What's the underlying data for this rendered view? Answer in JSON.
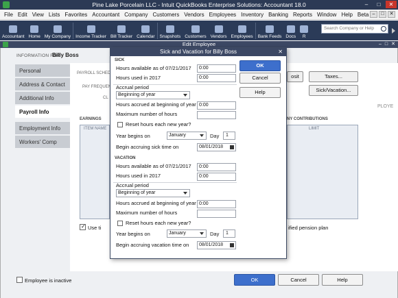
{
  "app": {
    "title": "Pine Lake Porcelain LLC  -  Intuit QuickBooks Enterprise Solutions: Accountant 18.0",
    "window_buttons": [
      "–",
      "□",
      "✕"
    ]
  },
  "menubar": {
    "items": [
      "File",
      "Edit",
      "View",
      "Lists",
      "Favorites",
      "Accountant",
      "Company",
      "Customers",
      "Vendors",
      "Employees",
      "Inventory",
      "Banking",
      "Reports",
      "Window",
      "Help",
      "Beta"
    ],
    "right_buttons": [
      "–",
      "□",
      "✕"
    ]
  },
  "iconbar": {
    "items": [
      {
        "label": "Accountant",
        "icon": "accountant-icon"
      },
      {
        "label": "Home",
        "icon": "home-icon"
      },
      {
        "label": "My Company",
        "icon": "my-company-icon"
      },
      {
        "label": "Income Tracker",
        "icon": "income-tracker-icon"
      },
      {
        "label": "Bill Tracker",
        "icon": "bill-tracker-icon"
      },
      {
        "label": "Calendar",
        "icon": "calendar-icon"
      },
      {
        "label": "Snapshots",
        "icon": "snapshots-icon"
      },
      {
        "label": "Customers",
        "icon": "customers-icon"
      },
      {
        "label": "Vendors",
        "icon": "vendors-icon"
      },
      {
        "label": "Employees",
        "icon": "employees-icon"
      },
      {
        "label": "Bank Feeds",
        "icon": "bank-feeds-icon"
      },
      {
        "label": "Docs",
        "icon": "docs-icon"
      },
      {
        "label": "R",
        "icon": "reports-icon"
      }
    ],
    "search_placeholder": "Search Company or Help"
  },
  "edit_employee": {
    "title": "Edit Employee",
    "title_controls": [
      "–",
      "□",
      "✕"
    ],
    "info_for_label": "INFORMATION FOR",
    "employee_name": "Billy Boss",
    "tabs": [
      "Personal",
      "Address & Contact",
      "Additional Info",
      "Payroll Info",
      "Employment Info",
      "Workers' Comp"
    ],
    "background": {
      "payroll_schedule_label": "PAYROLL SCHEDU",
      "pay_frequency_label": "PAY FREQUEN",
      "class_label": "CL",
      "direct_deposit_btn": "osit",
      "taxes_btn": "Taxes...",
      "sick_vacation_btn": "Sick/Vacation...",
      "earnings_label": "EARNINGS",
      "item_name_header": "ITEM NAME",
      "contributions_label": "NY CONTRIBUTIONS",
      "limit_header": "LIMIT",
      "right_cut_label": "PLOYE",
      "use_time_label": "Use ti",
      "pension_label": "ified pension plan"
    },
    "employee_inactive_label": "Employee is inactive",
    "ok_label": "OK",
    "cancel_label": "Cancel",
    "help_label": "Help"
  },
  "sick_vacation_dialog": {
    "title": "Sick and Vacation for Billy Boss",
    "close": "✕",
    "sick": {
      "section_label": "SICK",
      "hours_available_label": "Hours available as of 07/21/2017",
      "hours_available_value": "0:00",
      "hours_used_label": "Hours used in 2017",
      "hours_used_value": "0:00",
      "accrual_period_label": "Accrual period",
      "accrual_period_value": "Beginning of year",
      "hours_accrued_label": "Hours accrued at beginning of year",
      "hours_accrued_value": "0:00",
      "max_hours_label": "Maximum number of hours",
      "max_hours_value": "",
      "reset_label": "Reset hours each new year?",
      "year_begins_label": "Year begins on",
      "year_begins_value": "January",
      "day_label": "Day",
      "day_value": "1",
      "begin_accruing_label": "Begin accruing sick time on",
      "begin_accruing_value": "08/01/2018"
    },
    "vacation": {
      "section_label": "VACATION",
      "hours_available_label": "Hours available as of 07/21/2017",
      "hours_available_value": "0:00",
      "hours_used_label": "Hours used in 2017",
      "hours_used_value": "0:00",
      "accrual_period_label": "Accrual period",
      "accrual_period_value": "Beginning of year",
      "hours_accrued_label": "Hours accrued at beginning of year",
      "hours_accrued_value": "0:00",
      "max_hours_label": "Maximum number of hours",
      "max_hours_value": "",
      "reset_label": "Reset hours each new year?",
      "year_begins_label": "Year begins on",
      "year_begins_value": "January",
      "day_label": "Day",
      "day_value": "1",
      "begin_accruing_label": "Begin accruing vacation time on",
      "begin_accruing_value": "08/01/2018"
    },
    "ok_label": "OK",
    "cancel_label": "Cancel",
    "help_label": "Help"
  },
  "colors": {
    "title_bar": "#2c3a55",
    "primary_button": "#3d6fcc",
    "tab_bg": "#c8ccd2"
  }
}
